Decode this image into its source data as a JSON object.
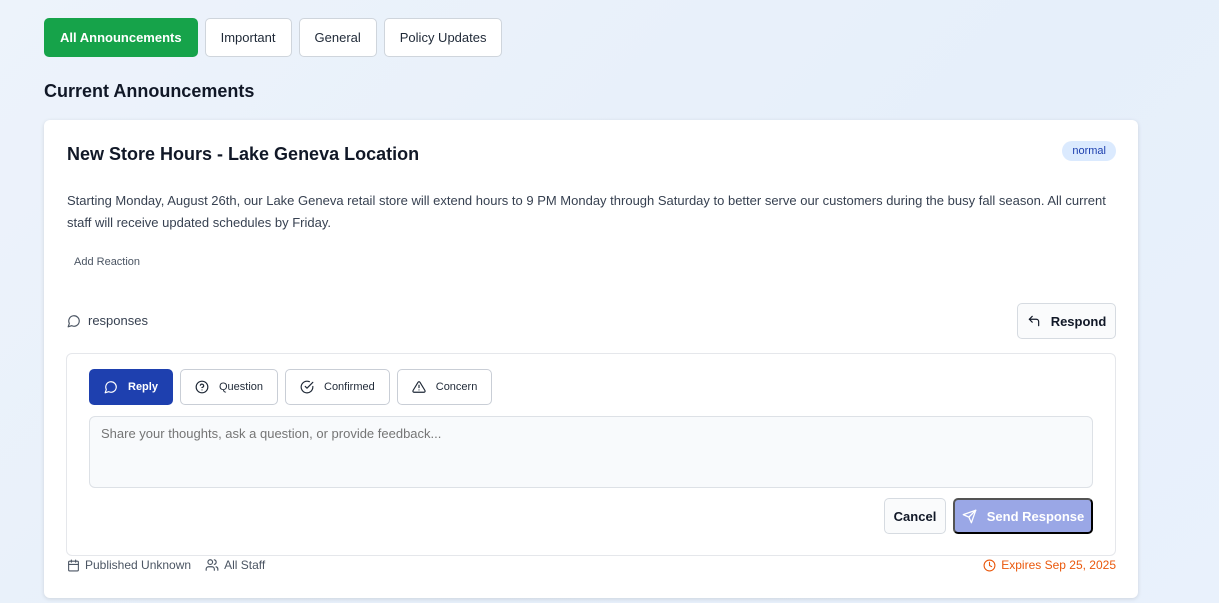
{
  "filters": [
    {
      "label": "All Announcements",
      "active": true
    },
    {
      "label": "Important",
      "active": false
    },
    {
      "label": "General",
      "active": false
    },
    {
      "label": "Policy Updates",
      "active": false
    }
  ],
  "section_title": "Current Announcements",
  "announcement": {
    "title": "New Store Hours - Lake Geneva Location",
    "priority_badge": "normal",
    "body": "Starting Monday, August 26th, our Lake Geneva retail store will extend hours to 9 PM Monday through Saturday to better serve our customers during the busy fall season. All current staff will receive updated schedules by Friday.",
    "add_reaction_label": "Add Reaction",
    "responses_label": "responses",
    "respond_label": "Respond",
    "published": "Published Unknown",
    "audience": "All Staff",
    "expires": "Expires Sep 25, 2025"
  },
  "response_form": {
    "types": [
      {
        "label": "Reply",
        "icon": "message-circle-icon",
        "active": true
      },
      {
        "label": "Question",
        "icon": "help-circle-icon",
        "active": false
      },
      {
        "label": "Confirmed",
        "icon": "check-circle-icon",
        "active": false
      },
      {
        "label": "Concern",
        "icon": "alert-triangle-icon",
        "active": false
      }
    ],
    "placeholder": "Share your thoughts, ask a question, or provide feedback...",
    "value": "",
    "cancel_label": "Cancel",
    "send_label": "Send Response"
  },
  "colors": {
    "active_filter": "#16a34a",
    "active_type": "#1e40af",
    "send_disabled": "#9aa7e6",
    "expires": "#ea580c",
    "badge_bg": "#dbeafe"
  }
}
